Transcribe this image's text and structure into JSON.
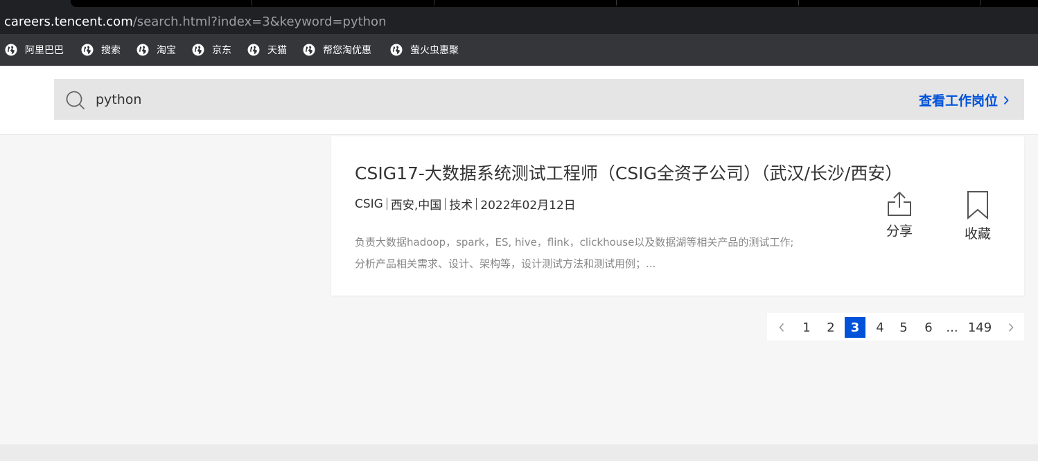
{
  "browser": {
    "url_host": "careers.tencent.com",
    "url_path": "/search.html?index=3&keyword=python",
    "bookmarks": [
      {
        "label": "阿里巴巴",
        "icon": "globe-icon"
      },
      {
        "label": "搜索",
        "icon": "globe-icon"
      },
      {
        "label": "淘宝",
        "icon": "globe-icon"
      },
      {
        "label": "京东",
        "icon": "globe-icon"
      },
      {
        "label": "天猫",
        "icon": "globe-icon"
      },
      {
        "label": "帮您淘优惠",
        "icon": "globe-icon"
      },
      {
        "label": "萤火虫惠聚",
        "icon": "globe-icon"
      }
    ]
  },
  "search": {
    "value": "python",
    "view_jobs_label": "查看工作岗位",
    "accent_color": "#0052d9"
  },
  "job": {
    "title": "CSIG17-大数据系统测试工程师（CSIG全资子公司）（武汉/长沙/西安）",
    "bg": "CSIG",
    "location": "西安,中国",
    "category": "技术",
    "date": "2022年02月12日",
    "desc_line1": "负责大数据hadoop，spark，ES, hive，flink，clickhouse以及数据湖等相关产品的测试工作;",
    "desc_line2": "分析产品相关需求、设计、架构等，设计测试方法和测试用例；...",
    "share_label": "分享",
    "save_label": "收藏"
  },
  "pagination": {
    "pages": [
      "1",
      "2",
      "3",
      "4",
      "5",
      "6",
      "...",
      "149"
    ],
    "current": "3"
  }
}
